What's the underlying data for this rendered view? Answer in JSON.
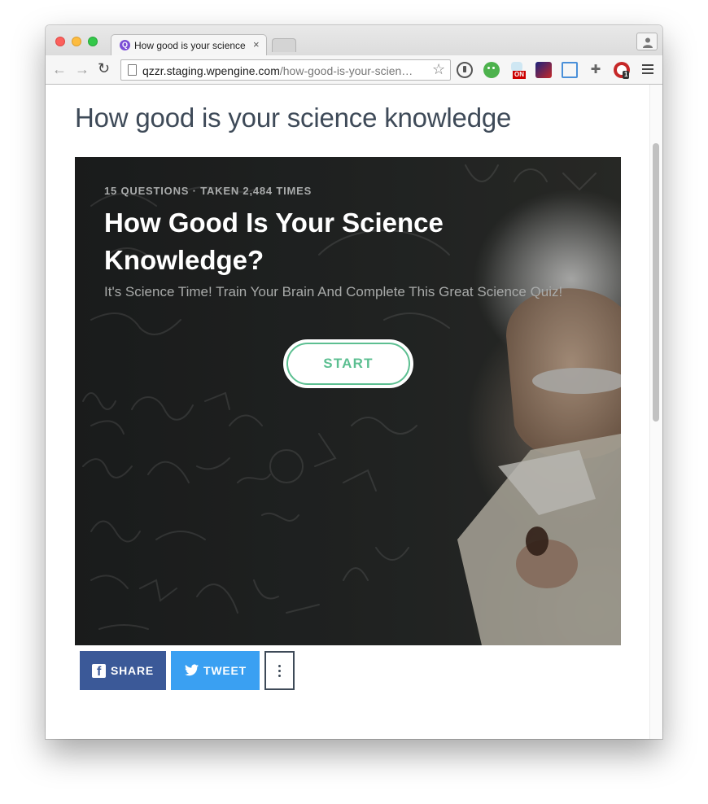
{
  "browser": {
    "tab_title": "How good is your science knowledge",
    "tab_close": "×",
    "url_host": "qzzr.staging.wpengine.com",
    "url_path": "/how-good-is-your-scien…",
    "extension_badges": {
      "on": "ON",
      "count": "1"
    }
  },
  "page": {
    "title": "How good is your science knowledge"
  },
  "quiz": {
    "meta": "15 QUESTIONS · TAKEN 2,484 TIMES",
    "title": "How Good Is Your Science Knowledge?",
    "description": "It's Science Time! Train Your Brain And Complete This Great Science Quiz!",
    "start_label": "START"
  },
  "share": {
    "facebook_label": "SHARE",
    "twitter_label": "TWEET"
  },
  "colors": {
    "title_text": "#3e4a58",
    "start_accent": "#5cbf91",
    "facebook": "#3b5998",
    "twitter": "#3aa0f2"
  }
}
